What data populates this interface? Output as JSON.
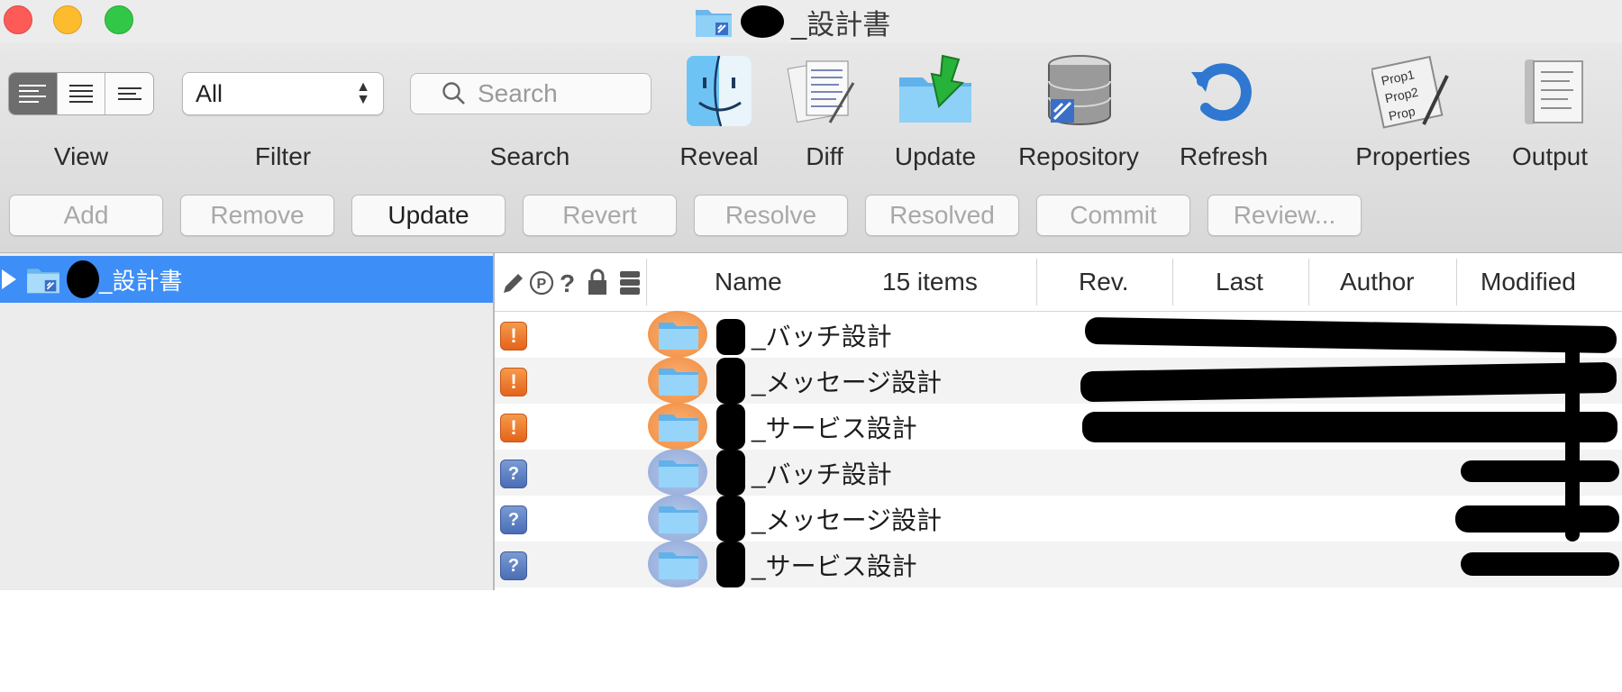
{
  "window": {
    "title": "_設計書"
  },
  "toolbar": {
    "view_label": "View",
    "filter_label": "Filter",
    "filter_value": "All",
    "search_label": "Search",
    "search_placeholder": "Search",
    "reveal_label": "Reveal",
    "diff_label": "Diff",
    "update_label": "Update",
    "repository_label": "Repository",
    "refresh_label": "Refresh",
    "properties_label": "Properties",
    "output_label": "Output",
    "properties_icon_lines": [
      "Prop1",
      "Prop2",
      "Prop"
    ]
  },
  "actions": {
    "add": "Add",
    "remove": "Remove",
    "update": "Update",
    "revert": "Revert",
    "resolve": "Resolve",
    "resolved": "Resolved",
    "commit": "Commit",
    "review": "Review..."
  },
  "sidebar": {
    "selected_item": "_設計書"
  },
  "table": {
    "columns": {
      "name": "Name",
      "count": "15 items",
      "rev": "Rev.",
      "last": "Last",
      "author": "Author",
      "modified": "Modified"
    },
    "rows": [
      {
        "status": "!",
        "status_type": "conflict",
        "name": "_バッチ設計"
      },
      {
        "status": "!",
        "status_type": "conflict",
        "name": "_メッセージ設計"
      },
      {
        "status": "!",
        "status_type": "conflict",
        "name": "_サービス設計"
      },
      {
        "status": "?",
        "status_type": "unversioned",
        "name": "_バッチ設計"
      },
      {
        "status": "?",
        "status_type": "unversioned",
        "name": "_メッセージ設計"
      },
      {
        "status": "?",
        "status_type": "unversioned",
        "name": "_サービス設計"
      }
    ]
  },
  "colors": {
    "selection": "#3e8ef7",
    "conflict_badge": "#e8701f",
    "unversioned_badge": "#5577bb"
  }
}
